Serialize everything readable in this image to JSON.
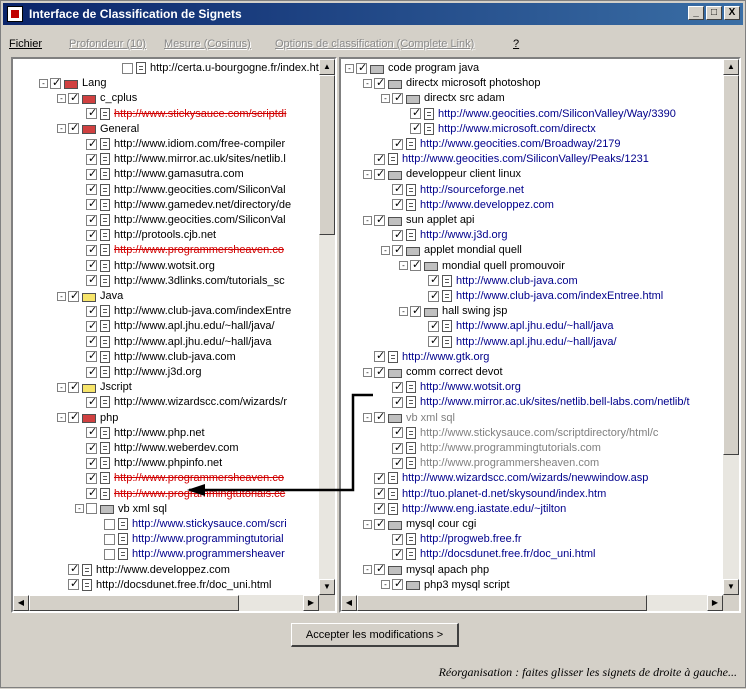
{
  "window": {
    "title": "Interface de Classification de Signets",
    "buttons": [
      "_",
      "□",
      "X"
    ]
  },
  "menu": [
    {
      "label": "Fichier",
      "enabled": true
    },
    {
      "label": "Profondeur (10)",
      "enabled": false
    },
    {
      "label": "Mesure (Cosinus)",
      "enabled": false
    },
    {
      "label": "Options de classification (Complete Link)",
      "enabled": false
    },
    {
      "label": "?",
      "enabled": true
    }
  ],
  "left_tree": [
    {
      "depth": 4,
      "pm": "",
      "checked": false,
      "icon": "doc",
      "label": "http://certa.u-bourgogne.fr/index.htm",
      "style": ""
    },
    {
      "depth": 0,
      "pm": "-",
      "checked": true,
      "icon": "folder-red",
      "label": "Lang",
      "style": ""
    },
    {
      "depth": 1,
      "pm": "-",
      "checked": true,
      "icon": "folder-red",
      "label": "c_cplus",
      "style": ""
    },
    {
      "depth": 2,
      "pm": "",
      "checked": true,
      "icon": "doc",
      "label": "http://www.stickysauce.com/scriptdi",
      "style": "strike"
    },
    {
      "depth": 1,
      "pm": "-",
      "checked": true,
      "icon": "folder-red",
      "label": "General",
      "style": ""
    },
    {
      "depth": 2,
      "pm": "",
      "checked": true,
      "icon": "doc",
      "label": "http://www.idiom.com/free-compiler",
      "style": ""
    },
    {
      "depth": 2,
      "pm": "",
      "checked": true,
      "icon": "doc",
      "label": "http://www.mirror.ac.uk/sites/netlib.l",
      "style": ""
    },
    {
      "depth": 2,
      "pm": "",
      "checked": true,
      "icon": "doc",
      "label": "http://www.gamasutra.com",
      "style": ""
    },
    {
      "depth": 2,
      "pm": "",
      "checked": true,
      "icon": "doc",
      "label": "http://www.geocities.com/SiliconVal",
      "style": ""
    },
    {
      "depth": 2,
      "pm": "",
      "checked": true,
      "icon": "doc",
      "label": "http://www.gamedev.net/directory/de",
      "style": ""
    },
    {
      "depth": 2,
      "pm": "",
      "checked": true,
      "icon": "doc",
      "label": "http://www.geocities.com/SiliconVal",
      "style": ""
    },
    {
      "depth": 2,
      "pm": "",
      "checked": true,
      "icon": "doc",
      "label": "http://protools.cjb.net",
      "style": ""
    },
    {
      "depth": 2,
      "pm": "",
      "checked": true,
      "icon": "doc",
      "label": "http://www.programmersheaven.co",
      "style": "strike"
    },
    {
      "depth": 2,
      "pm": "",
      "checked": true,
      "icon": "doc",
      "label": "http://www.wotsit.org",
      "style": ""
    },
    {
      "depth": 2,
      "pm": "",
      "checked": true,
      "icon": "doc",
      "label": "http://www.3dlinks.com/tutorials_sc",
      "style": ""
    },
    {
      "depth": 1,
      "pm": "-",
      "checked": true,
      "icon": "folder-yellow",
      "label": "Java",
      "style": ""
    },
    {
      "depth": 2,
      "pm": "",
      "checked": true,
      "icon": "doc",
      "label": "http://www.club-java.com/indexEntre",
      "style": ""
    },
    {
      "depth": 2,
      "pm": "",
      "checked": true,
      "icon": "doc",
      "label": "http://www.apl.jhu.edu/~hall/java/",
      "style": ""
    },
    {
      "depth": 2,
      "pm": "",
      "checked": true,
      "icon": "doc",
      "label": "http://www.apl.jhu.edu/~hall/java",
      "style": ""
    },
    {
      "depth": 2,
      "pm": "",
      "checked": true,
      "icon": "doc",
      "label": "http://www.club-java.com",
      "style": ""
    },
    {
      "depth": 2,
      "pm": "",
      "checked": true,
      "icon": "doc",
      "label": "http://www.j3d.org",
      "style": ""
    },
    {
      "depth": 1,
      "pm": "-",
      "checked": true,
      "icon": "folder-yellow",
      "label": "Jscript",
      "style": ""
    },
    {
      "depth": 2,
      "pm": "",
      "checked": true,
      "icon": "doc",
      "label": "http://www.wizardscc.com/wizards/r",
      "style": ""
    },
    {
      "depth": 1,
      "pm": "-",
      "checked": true,
      "icon": "folder-red",
      "label": "php",
      "style": ""
    },
    {
      "depth": 2,
      "pm": "",
      "checked": true,
      "icon": "doc",
      "label": "http://www.php.net",
      "style": ""
    },
    {
      "depth": 2,
      "pm": "",
      "checked": true,
      "icon": "doc",
      "label": "http://www.weberdev.com",
      "style": ""
    },
    {
      "depth": 2,
      "pm": "",
      "checked": true,
      "icon": "doc",
      "label": "http://www.phpinfo.net",
      "style": ""
    },
    {
      "depth": 2,
      "pm": "",
      "checked": true,
      "icon": "doc",
      "label": "http://www.programmersheaven.co",
      "style": "strike"
    },
    {
      "depth": 2,
      "pm": "",
      "checked": true,
      "icon": "doc",
      "label": "http://www.programmingtutorials.cc",
      "style": "strike"
    },
    {
      "depth": 2,
      "pm": "-",
      "checked": false,
      "icon": "folder",
      "label": "vb xml sql",
      "style": ""
    },
    {
      "depth": 3,
      "pm": "",
      "checked": false,
      "icon": "doc",
      "label": "http://www.stickysauce.com/scri",
      "style": "link"
    },
    {
      "depth": 3,
      "pm": "",
      "checked": false,
      "icon": "doc",
      "label": "http://www.programmingtutorial",
      "style": "link"
    },
    {
      "depth": 3,
      "pm": "",
      "checked": false,
      "icon": "doc",
      "label": "http://www.programmersheaver",
      "style": "link"
    },
    {
      "depth": 1,
      "pm": "",
      "checked": true,
      "icon": "doc",
      "label": "http://www.developpez.com",
      "style": ""
    },
    {
      "depth": 1,
      "pm": "",
      "checked": true,
      "icon": "doc",
      "label": "http://docsdunet.free.fr/doc_uni.html",
      "style": ""
    }
  ],
  "right_tree": [
    {
      "depth": 0,
      "pm": "-",
      "checked": true,
      "icon": "folder",
      "label": "code program java",
      "style": ""
    },
    {
      "depth": 1,
      "pm": "-",
      "checked": true,
      "icon": "folder",
      "label": "directx microsoft photoshop",
      "style": ""
    },
    {
      "depth": 2,
      "pm": "-",
      "checked": true,
      "icon": "folder",
      "label": "directx src adam",
      "style": ""
    },
    {
      "depth": 3,
      "pm": "",
      "checked": true,
      "icon": "doc",
      "label": "http://www.geocities.com/SiliconValley/Way/3390",
      "style": "link"
    },
    {
      "depth": 3,
      "pm": "",
      "checked": true,
      "icon": "doc",
      "label": "http://www.microsoft.com/directx",
      "style": "link"
    },
    {
      "depth": 2,
      "pm": "",
      "checked": true,
      "icon": "doc",
      "label": "http://www.geocities.com/Broadway/2179",
      "style": "link"
    },
    {
      "depth": 1,
      "pm": "",
      "checked": true,
      "icon": "doc",
      "label": "http://www.geocities.com/SiliconValley/Peaks/1231",
      "style": "link"
    },
    {
      "depth": 1,
      "pm": "-",
      "checked": true,
      "icon": "folder",
      "label": "developpeur client linux",
      "style": ""
    },
    {
      "depth": 2,
      "pm": "",
      "checked": true,
      "icon": "doc",
      "label": "http://sourceforge.net",
      "style": "link"
    },
    {
      "depth": 2,
      "pm": "",
      "checked": true,
      "icon": "doc",
      "label": "http://www.developpez.com",
      "style": "link"
    },
    {
      "depth": 1,
      "pm": "-",
      "checked": true,
      "icon": "folder",
      "label": "sun applet api",
      "style": ""
    },
    {
      "depth": 2,
      "pm": "",
      "checked": true,
      "icon": "doc",
      "label": "http://www.j3d.org",
      "style": "link"
    },
    {
      "depth": 2,
      "pm": "-",
      "checked": true,
      "icon": "folder",
      "label": "applet mondial quell",
      "style": ""
    },
    {
      "depth": 3,
      "pm": "-",
      "checked": true,
      "icon": "folder",
      "label": "mondial quell promouvoir",
      "style": ""
    },
    {
      "depth": 4,
      "pm": "",
      "checked": true,
      "icon": "doc",
      "label": "http://www.club-java.com",
      "style": "link"
    },
    {
      "depth": 4,
      "pm": "",
      "checked": true,
      "icon": "doc",
      "label": "http://www.club-java.com/indexEntree.html",
      "style": "link"
    },
    {
      "depth": 3,
      "pm": "-",
      "checked": true,
      "icon": "folder",
      "label": "hall swing jsp",
      "style": ""
    },
    {
      "depth": 4,
      "pm": "",
      "checked": true,
      "icon": "doc",
      "label": "http://www.apl.jhu.edu/~hall/java",
      "style": "link"
    },
    {
      "depth": 4,
      "pm": "",
      "checked": true,
      "icon": "doc",
      "label": "http://www.apl.jhu.edu/~hall/java/",
      "style": "link"
    },
    {
      "depth": 1,
      "pm": "",
      "checked": true,
      "icon": "doc",
      "label": "http://www.gtk.org",
      "style": "link"
    },
    {
      "depth": 1,
      "pm": "-",
      "checked": true,
      "icon": "folder",
      "label": "comm correct devot",
      "style": ""
    },
    {
      "depth": 2,
      "pm": "",
      "checked": true,
      "icon": "doc",
      "label": "http://www.wotsit.org",
      "style": "link"
    },
    {
      "depth": 2,
      "pm": "",
      "checked": true,
      "icon": "doc",
      "label": "http://www.mirror.ac.uk/sites/netlib.bell-labs.com/netlib/t",
      "style": "link"
    },
    {
      "depth": 1,
      "pm": "-",
      "checked": true,
      "icon": "folder",
      "label": "vb xml sql",
      "style": "gray"
    },
    {
      "depth": 2,
      "pm": "",
      "checked": true,
      "icon": "doc",
      "label": "http://www.stickysauce.com/scriptdirectory/html/c",
      "style": "gray"
    },
    {
      "depth": 2,
      "pm": "",
      "checked": true,
      "icon": "doc",
      "label": "http://www.programmingtutorials.com",
      "style": "gray"
    },
    {
      "depth": 2,
      "pm": "",
      "checked": true,
      "icon": "doc",
      "label": "http://www.programmersheaven.com",
      "style": "gray"
    },
    {
      "depth": 1,
      "pm": "",
      "checked": true,
      "icon": "doc",
      "label": "http://www.wizardscc.com/wizards/newwindow.asp",
      "style": "link"
    },
    {
      "depth": 1,
      "pm": "",
      "checked": true,
      "icon": "doc",
      "label": "http://tuo.planet-d.net/skysound/index.htm",
      "style": "link"
    },
    {
      "depth": 1,
      "pm": "",
      "checked": true,
      "icon": "doc",
      "label": "http://www.eng.iastate.edu/~jtilton",
      "style": "link"
    },
    {
      "depth": 1,
      "pm": "-",
      "checked": true,
      "icon": "folder",
      "label": "mysql cour cgi",
      "style": ""
    },
    {
      "depth": 2,
      "pm": "",
      "checked": true,
      "icon": "doc",
      "label": "http://progweb.free.fr",
      "style": "link"
    },
    {
      "depth": 2,
      "pm": "",
      "checked": true,
      "icon": "doc",
      "label": "http://docsdunet.free.fr/doc_uni.html",
      "style": "link"
    },
    {
      "depth": 1,
      "pm": "-",
      "checked": true,
      "icon": "folder",
      "label": "mysql apach php",
      "style": ""
    },
    {
      "depth": 2,
      "pm": "-",
      "checked": true,
      "icon": "folder",
      "label": "php3 mysql script",
      "style": ""
    }
  ],
  "accept_button": "Accepter les modifications >",
  "status": "Réorganisation : faites glisser les signets de droite à gauche..."
}
